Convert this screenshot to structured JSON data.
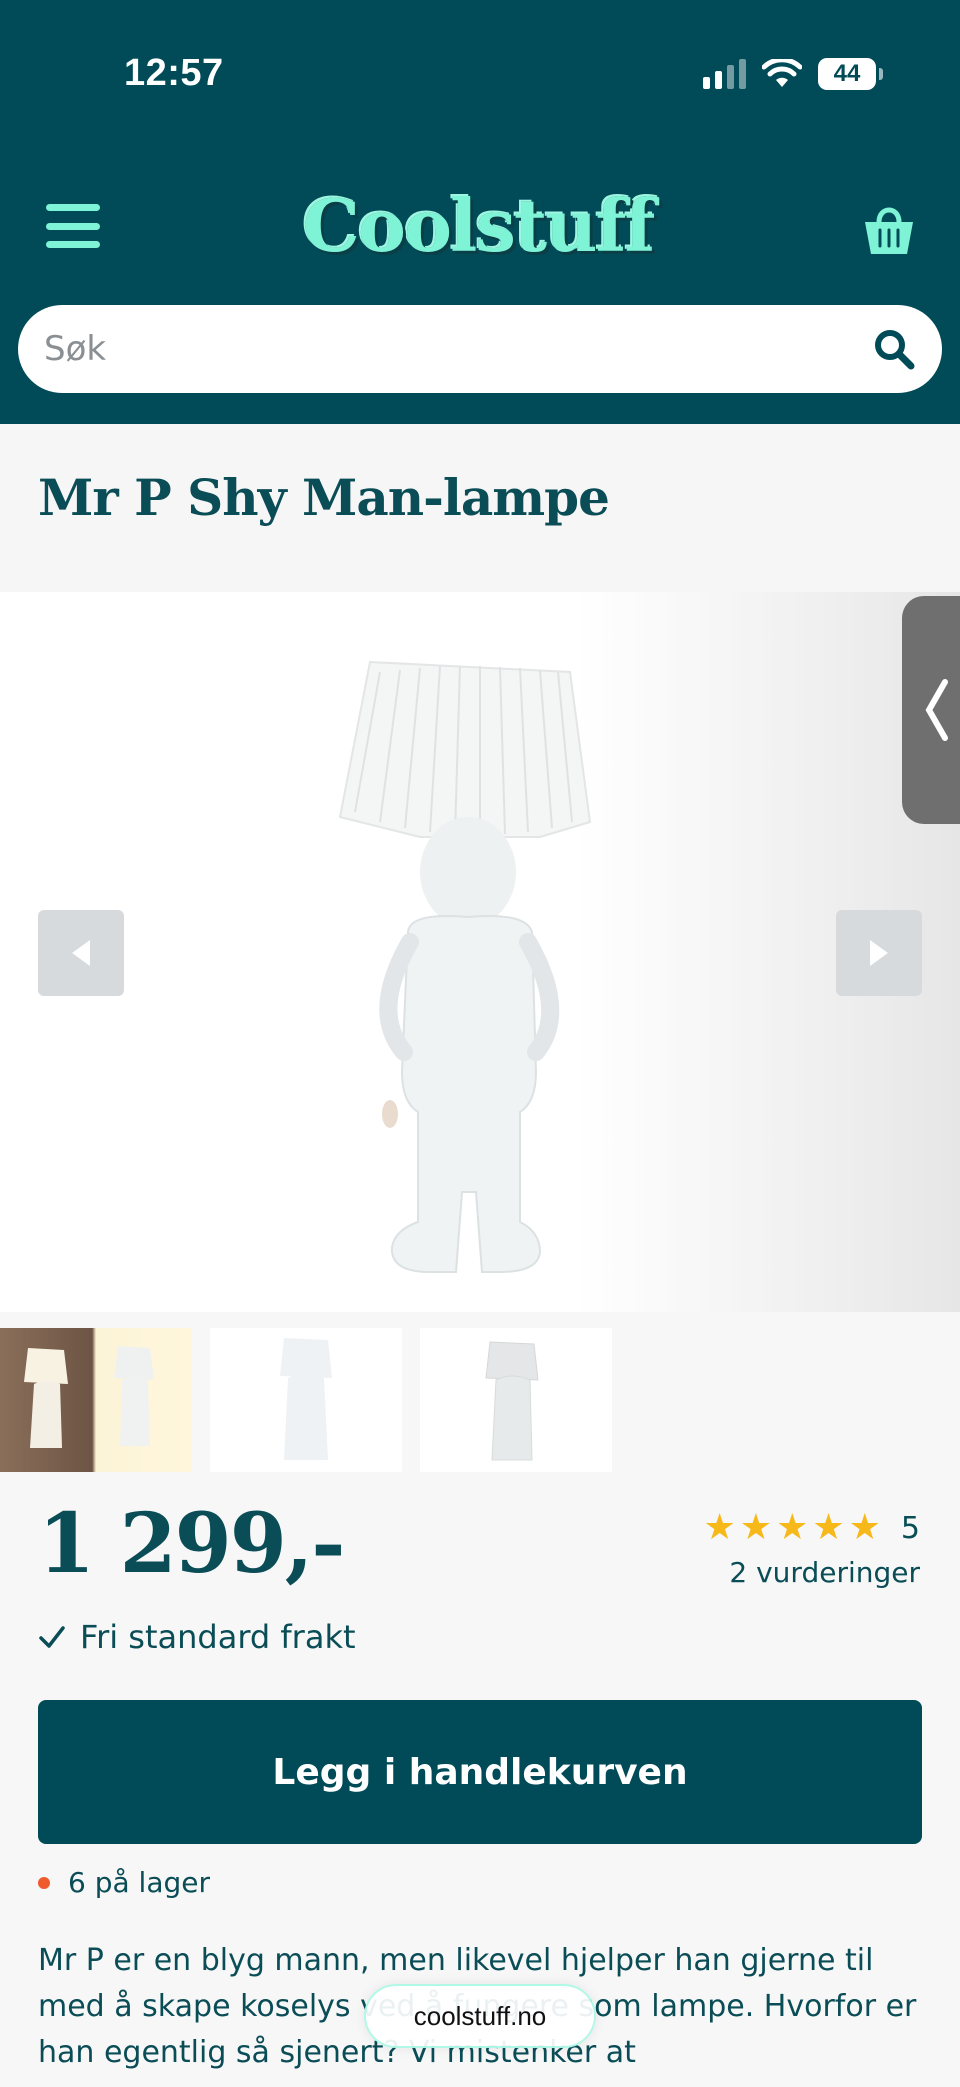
{
  "status_bar": {
    "time": "12:57",
    "battery": "44"
  },
  "header": {
    "logo_text": "Coolstuff",
    "menu_icon": "menu-icon",
    "cart_icon": "basket-icon",
    "brand_color": "#004b57",
    "accent_color": "#7ff3d5"
  },
  "search": {
    "placeholder": "Søk",
    "value": "",
    "icon": "search-icon"
  },
  "product": {
    "title": "Mr P Shy Man-lampe",
    "price": "1 299,-",
    "rating_value": "5",
    "rating_stars": 5,
    "rating_count": "2 vurderinger",
    "shipping": "Fri standard frakt",
    "add_to_cart_label": "Legg i handlekurven",
    "stock": "6 på lager",
    "description": "Mr P er en blyg mann, men likevel hjelper han gjerne til med å skape koselys ved å fungere som lampe. Hvorfor er han egentlig så sjenert? Vi mistenker at"
  },
  "gallery": {
    "prev_icon": "triangle-left-icon",
    "next_icon": "triangle-right-icon",
    "side_tab_icon": "chevron-left-icon",
    "thumbnail_count": 3
  },
  "browser": {
    "url": "coolstuff.no"
  }
}
